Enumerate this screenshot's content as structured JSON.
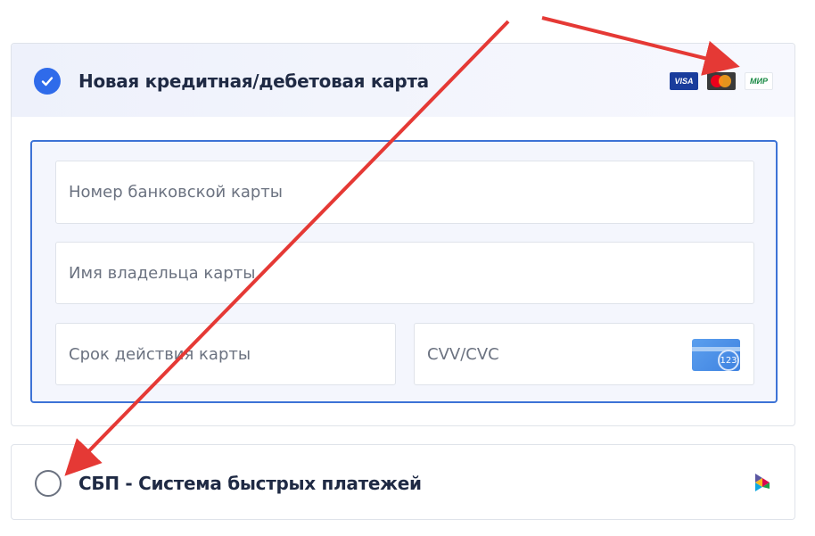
{
  "card_option": {
    "title": "Новая кредитная/дебетовая карта",
    "selected": true,
    "logos": {
      "visa": "VISA",
      "mir": "МИР"
    }
  },
  "form": {
    "card_number_placeholder": "Номер банковской карты",
    "holder_name_placeholder": "Имя владельца карты",
    "expiry_placeholder": "Срок действия карты",
    "cvv_placeholder": "CVV/CVC",
    "cvv_hint_number": "123"
  },
  "sbp_option": {
    "title": "СБП - Система быстрых платежей",
    "selected": false
  },
  "colors": {
    "accent": "#2f6bea",
    "form_border": "#3d73d6",
    "annotation_arrow": "#e53935"
  }
}
